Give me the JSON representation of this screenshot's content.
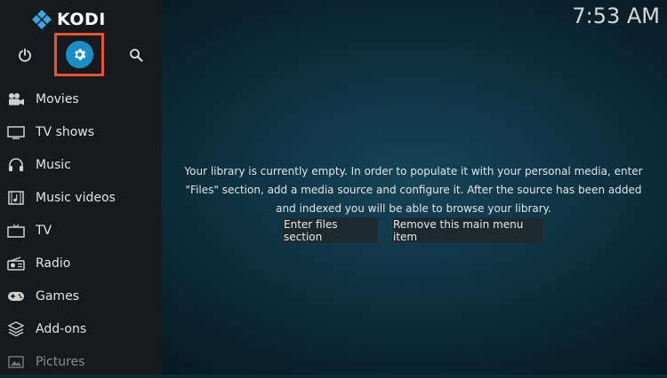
{
  "app": {
    "logo_text": "KODI",
    "clock": "7:53 AM"
  },
  "top_icons": {
    "power": "power-icon",
    "settings": "gear-icon",
    "search": "search-icon"
  },
  "colors": {
    "accent": "#1a8ec6",
    "highlight_box": "#e8542f",
    "sidebar": "#161a1d",
    "logo_blue": "#3aa6dd"
  },
  "sidebar": {
    "items": [
      {
        "label": "Movies",
        "icon": "movies-icon"
      },
      {
        "label": "TV shows",
        "icon": "tv-shows-icon"
      },
      {
        "label": "Music",
        "icon": "headphones-icon"
      },
      {
        "label": "Music videos",
        "icon": "music-videos-icon"
      },
      {
        "label": "TV",
        "icon": "tv-icon"
      },
      {
        "label": "Radio",
        "icon": "radio-icon"
      },
      {
        "label": "Games",
        "icon": "gamepad-icon"
      },
      {
        "label": "Add-ons",
        "icon": "addons-icon"
      },
      {
        "label": "Pictures",
        "icon": "pictures-icon"
      }
    ]
  },
  "main": {
    "message": "Your library is currently empty. In order to populate it with your personal media, enter \"Files\" section, add a media source and configure it. After the source has been added and indexed you will be able to browse your library.",
    "enter_files_label": "Enter files section",
    "remove_item_label": "Remove this main menu item"
  }
}
